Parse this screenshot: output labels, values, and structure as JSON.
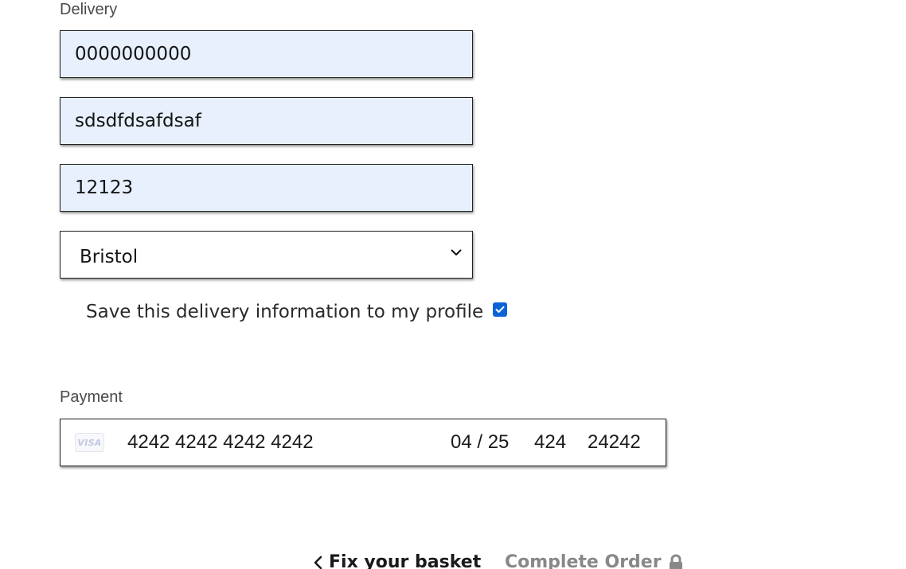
{
  "delivery": {
    "section_label": "Delivery",
    "phone_value": "0000000000",
    "address_value": "sdsdfdsafdsaf",
    "postcode_value": "12123",
    "county_selected": "Bristol",
    "save_info_label": "Save this delivery information to my profile",
    "save_info_checked": true
  },
  "payment": {
    "section_label": "Payment",
    "card_brand": "VISA",
    "card_number": "4242 4242 4242 4242",
    "expiry": "04 / 25",
    "cvc": "424",
    "postal": "24242"
  },
  "actions": {
    "back_label": "Fix your basket",
    "complete_label": "Complete Order"
  },
  "colors": {
    "autofill_bg": "#e8f0fe",
    "checkbox_blue": "#0b63d6",
    "disabled_text": "#888888"
  },
  "icons": {
    "select_arrow": "chevron-down-icon",
    "back": "chevron-left-icon",
    "complete": "lock-icon",
    "checkbox": "checkmark-icon"
  }
}
